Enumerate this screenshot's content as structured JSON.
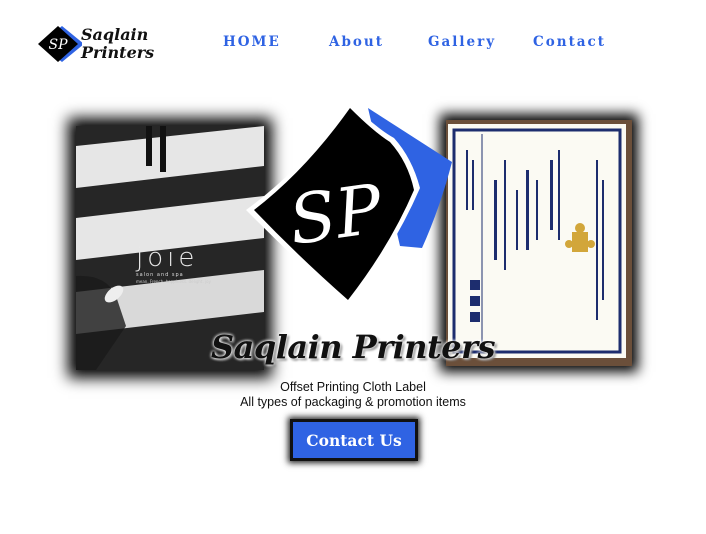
{
  "brand": {
    "name": "Saqlain Printers",
    "logo_line1": "Saqlain",
    "logo_line2": "Printers",
    "monogram": "SP",
    "colors": {
      "accent": "#2f63e3",
      "dark": "#000000",
      "text": "#111111"
    }
  },
  "nav": {
    "items": [
      {
        "label": "HOME"
      },
      {
        "label": "About"
      },
      {
        "label": "Gallery"
      },
      {
        "label": "Contact"
      }
    ]
  },
  "hero": {
    "title": "Saqlain Printers",
    "tagline_line1": "Offset Printing Cloth Label",
    "tagline_line2": "All types of packaging & promotion items",
    "cta_label": "Contact Us",
    "left_photo": {
      "word": "joie",
      "sub": "salon and spa",
      "tag": "mean. French. happiness. delight. joy"
    }
  }
}
